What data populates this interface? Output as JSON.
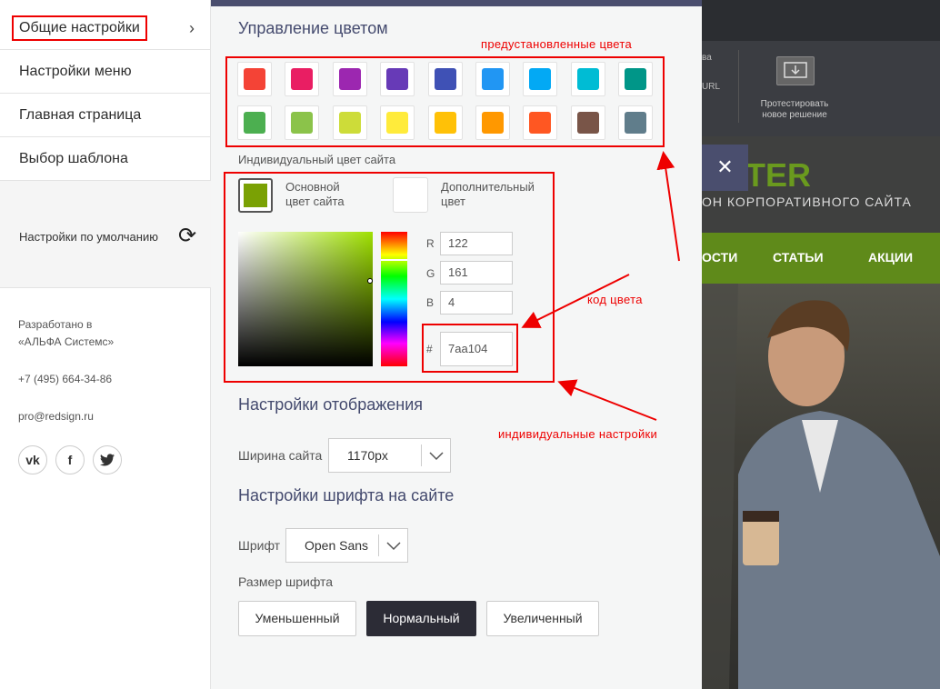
{
  "sidebar": {
    "items": [
      {
        "label": "Общие настройки"
      },
      {
        "label": "Настройки меню"
      },
      {
        "label": "Главная страница"
      },
      {
        "label": "Выбор шаблона"
      }
    ],
    "defaults_label": "Настройки по умолчанию",
    "footer": {
      "developed_line1": "Разработано в",
      "developed_line2": "«АЛЬФА Системс»",
      "phone": "+7 (495) 664-34-86",
      "email": "pro@redsign.ru"
    },
    "social": [
      {
        "name": "vk-icon",
        "glyph": "vk"
      },
      {
        "name": "facebook-icon",
        "glyph": "f"
      },
      {
        "name": "twitter-icon",
        "glyph": "🐦"
      }
    ]
  },
  "panel": {
    "color_title": "Управление цветом",
    "annotation_preset": "предустановленные цвета",
    "preset_colors": [
      "#f44336",
      "#e91e63",
      "#9c27b0",
      "#673ab7",
      "#3f51b5",
      "#2196f3",
      "#03a9f4",
      "#00bcd4",
      "#009688",
      "#4caf50",
      "#8bc34a",
      "#cddc39",
      "#ffeb3b",
      "#ffc107",
      "#ff9800",
      "#ff5722",
      "#795548",
      "#607d8b"
    ],
    "individual_label": "Индивидуальный цвет сайта",
    "main_color_label_1": "Основной",
    "main_color_label_2": "цвет сайта",
    "main_color": "#7aa104",
    "extra_color_label_1": "Дополнительный",
    "extra_color_label_2": "цвет",
    "extra_color": "#ffffff",
    "r_label": "R",
    "r_value": "122",
    "g_label": "G",
    "g_value": "161",
    "b_label": "B",
    "b_value": "4",
    "hex_label": "#",
    "hex_value": "7aa104",
    "annotation_code": "код цвета",
    "annotation_individual": "индивидуальные настройки",
    "display_title": "Настройки отображения",
    "width_label": "Ширина сайта",
    "width_value": "1170px",
    "font_title": "Настройки шрифта на сайте",
    "font_label": "Шрифт",
    "font_value": "Open Sans",
    "font_size_label": "Размер шрифта",
    "font_sizes": [
      "Уменьшенный",
      "Нормальный",
      "Увеличенный"
    ],
    "selected_font_size": "Нормальный"
  },
  "site": {
    "toolbar_text_1": "Протестировать",
    "toolbar_text_2": "новое решение",
    "toolbar_small_1": "ва",
    "toolbar_small_2": "URL",
    "logo_fragment": "TER",
    "tagline_fragment": "ОН КОРПОРАТИВНОГО САЙТА",
    "nav_items": [
      "ОСТИ",
      "СТАТЬИ",
      "АКЦИИ"
    ],
    "close_glyph": "✕"
  },
  "colors": {
    "accent": "#4a4e6e",
    "annotation_red": "#ee0000",
    "site_green": "#5f8a1a"
  }
}
